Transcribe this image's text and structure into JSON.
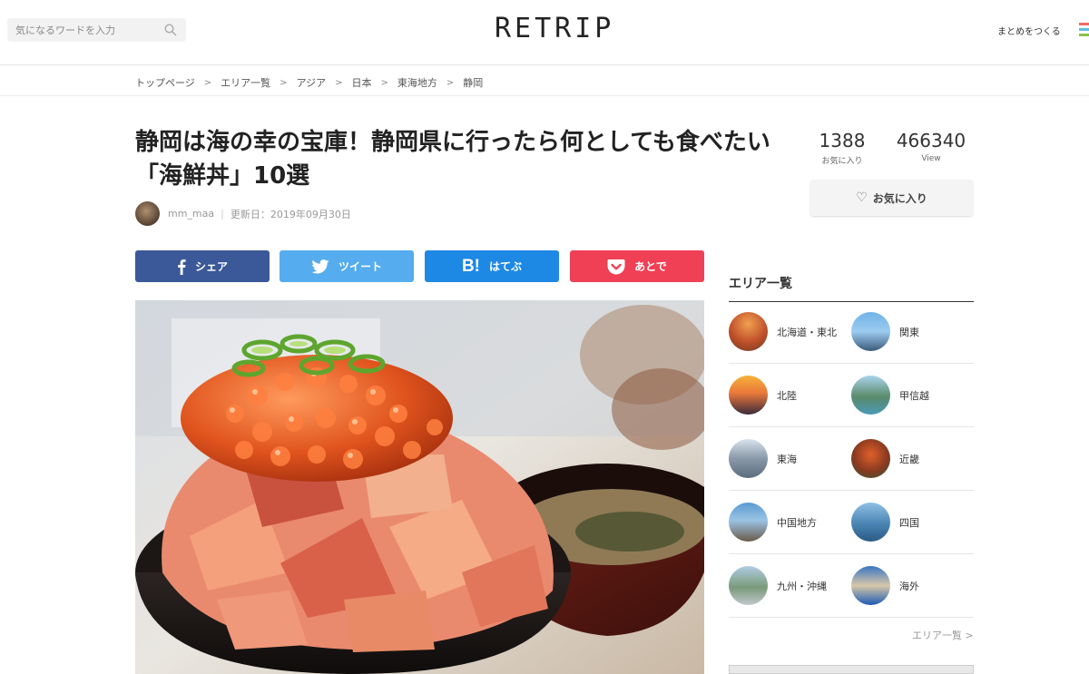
{
  "header": {
    "search_placeholder": "気になるワードを入力",
    "logo": "RETRIP",
    "make_summary": "まとめをつくる",
    "menu_colors": [
      "#f06b6b",
      "#5bc0de",
      "#8bc34a"
    ]
  },
  "breadcrumb": [
    "トップページ",
    "エリア一覧",
    "アジア",
    "日本",
    "東海地方",
    "静岡"
  ],
  "breadcrumb_sep": ">",
  "article": {
    "title": "静岡は海の幸の宝庫！静岡県に行ったら何としても食べたい「海鮮丼」10選",
    "author": "mm_maa",
    "updated": "更新日：2019年09月30日",
    "divider": "|"
  },
  "share": {
    "facebook": "シェア",
    "twitter": "ツイート",
    "hatena": "はてぶ",
    "hatena_icon": "B!",
    "pocket": "あとで",
    "colors": {
      "facebook": "#3b5998",
      "twitter": "#55acee",
      "hatena": "#1e88e5",
      "pocket": "#ef4056"
    }
  },
  "stats": {
    "favorites": "1388",
    "favorites_label": "お気に入り",
    "views": "466340",
    "views_label": "View"
  },
  "fav_button": "お気に入り",
  "areas": {
    "heading": "エリア一覧",
    "items": [
      {
        "name": "北海道・東北",
        "icon": "autumn-lake-photo"
      },
      {
        "name": "関東",
        "icon": "tokyo-tower-photo"
      },
      {
        "name": "北陸",
        "icon": "sunset-field-photo"
      },
      {
        "name": "甲信越",
        "icon": "mountain-lake-photo"
      },
      {
        "name": "東海",
        "icon": "fuji-reflection-photo"
      },
      {
        "name": "近畿",
        "icon": "kyoto-autumn-photo"
      },
      {
        "name": "中国地方",
        "icon": "kintai-bridge-photo"
      },
      {
        "name": "四国",
        "icon": "seto-bridge-photo"
      },
      {
        "name": "九州・沖縄",
        "icon": "volcano-coast-photo"
      },
      {
        "name": "海外",
        "icon": "coastal-city-photo"
      }
    ],
    "more": "エリア一覧 >"
  }
}
